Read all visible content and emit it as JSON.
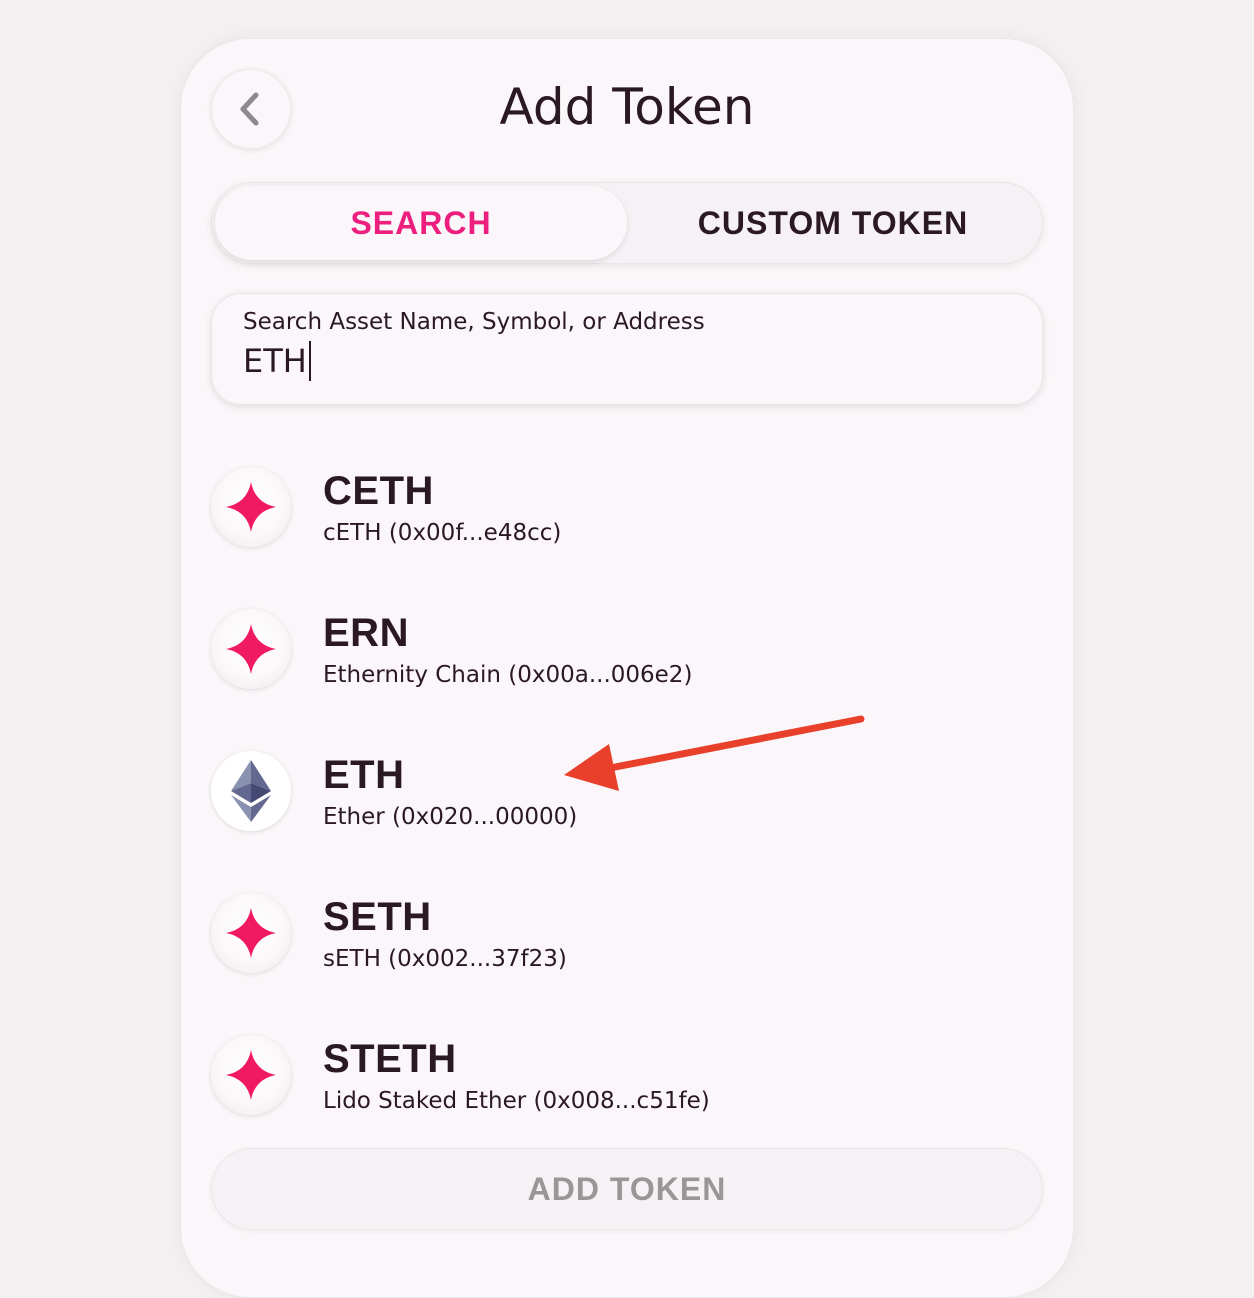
{
  "header": {
    "title": "Add Token"
  },
  "tabs": [
    {
      "label": "SEARCH",
      "active": true
    },
    {
      "label": "CUSTOM TOKEN",
      "active": false
    }
  ],
  "search": {
    "label": "Search Asset Name, Symbol, or Address",
    "value": "ETH"
  },
  "tokens": [
    {
      "symbol": "CETH",
      "description": "cETH (0x00f...e48cc)",
      "icon": "sparkle-icon"
    },
    {
      "symbol": "ERN",
      "description": "Ethernity Chain (0x00a...006e2)",
      "icon": "sparkle-icon"
    },
    {
      "symbol": "ETH",
      "description": "Ether (0x020...00000)",
      "icon": "ethereum-icon"
    },
    {
      "symbol": "SETH",
      "description": "sETH (0x002...37f23)",
      "icon": "sparkle-icon"
    },
    {
      "symbol": "STETH",
      "description": "Lido Staked Ether (0x008...c51fe)",
      "icon": "sparkle-icon"
    }
  ],
  "footer": {
    "add_button_label": "ADD TOKEN"
  },
  "colors": {
    "accent": "#ec1f7f",
    "sparkle": "#f01a62",
    "arrow": "#e8402a",
    "text": "#2a1822",
    "disabled": "#9b9598"
  }
}
